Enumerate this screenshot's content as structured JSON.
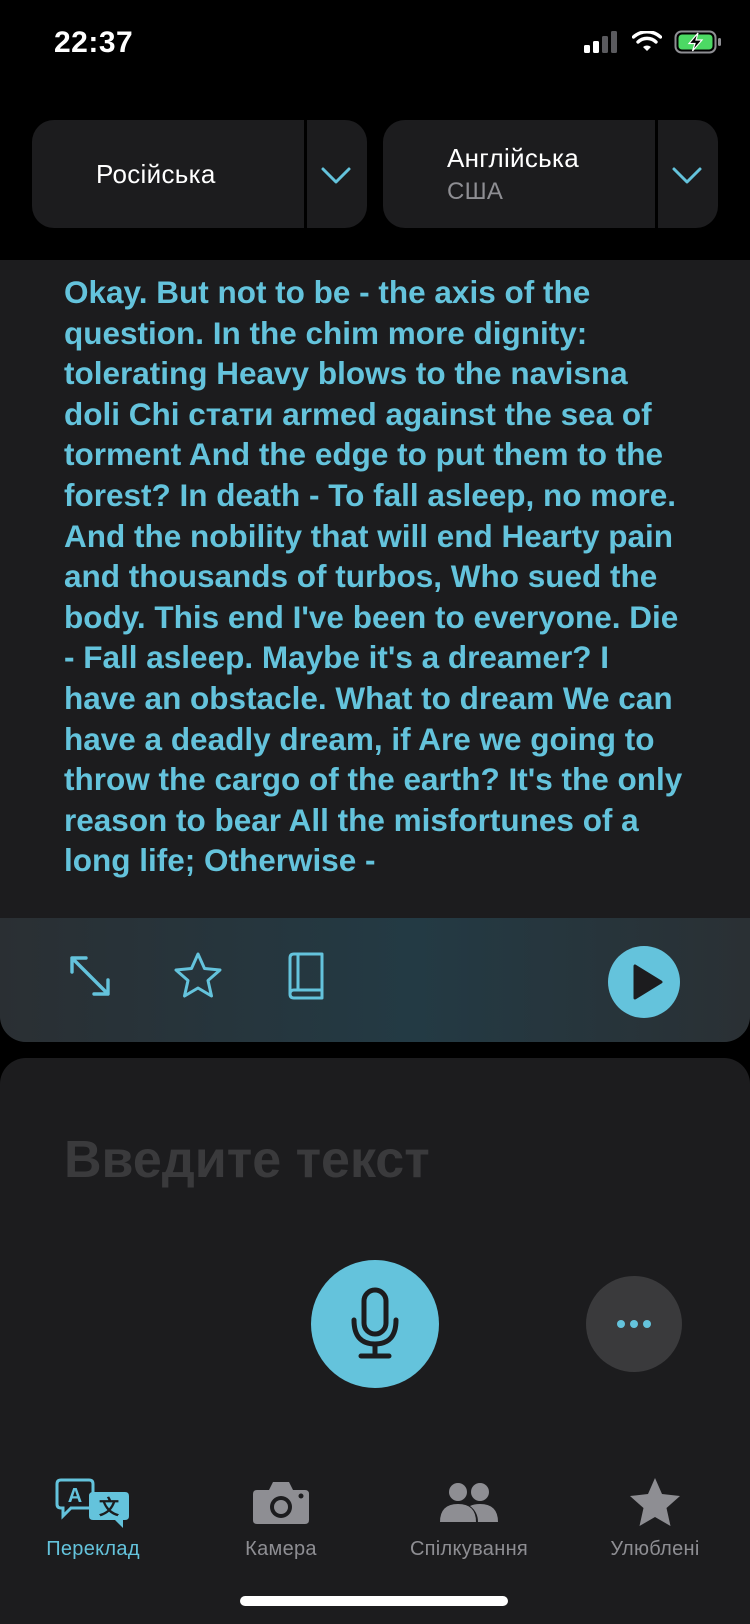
{
  "status_bar": {
    "time": "22:37",
    "signal_icon": "cellular-signal-icon",
    "wifi_icon": "wifi-icon",
    "battery_icon": "battery-charging-icon"
  },
  "languages": {
    "source": {
      "name": "Російська"
    },
    "target": {
      "name": "Англійська",
      "variant": "США"
    },
    "chevron_icon": "chevron-down-icon"
  },
  "translation": {
    "text": "Okay. But not to be - the axis of the question. In the chim more dignity: tolerating Heavy blows to the navisna doli Chi стати armed against the sea of torment And the edge to put them to the forest? In death - To fall asleep, no more. And the nobility that will end Hearty pain and thousands of turbos, Who sued the body. This end I've been to everyone. Die - Fall asleep. Maybe it's a dreamer? I have an obstacle. What to dream We can have a deadly dream, if Are we going to throw the cargo of the earth? It's the only reason to bear All the misfortunes of a long life; Otherwise -",
    "actions": {
      "expand_icon": "expand-icon",
      "favorite_icon": "star-icon",
      "dictionary_icon": "book-icon",
      "play_icon": "play-icon"
    }
  },
  "input": {
    "placeholder": "Введите текст",
    "mic_icon": "microphone-icon",
    "more_icon": "more-icon"
  },
  "tabs": [
    {
      "label": "Переклад",
      "icon": "translate-icon",
      "active": true
    },
    {
      "label": "Камера",
      "icon": "camera-icon",
      "active": false
    },
    {
      "label": "Спілкування",
      "icon": "people-icon",
      "active": false
    },
    {
      "label": "Улюблені",
      "icon": "star-filled-icon",
      "active": false
    }
  ],
  "colors": {
    "accent": "#64c3dc",
    "background": "#000000",
    "surface": "#1c1c1e",
    "muted": "#8e8e93"
  }
}
